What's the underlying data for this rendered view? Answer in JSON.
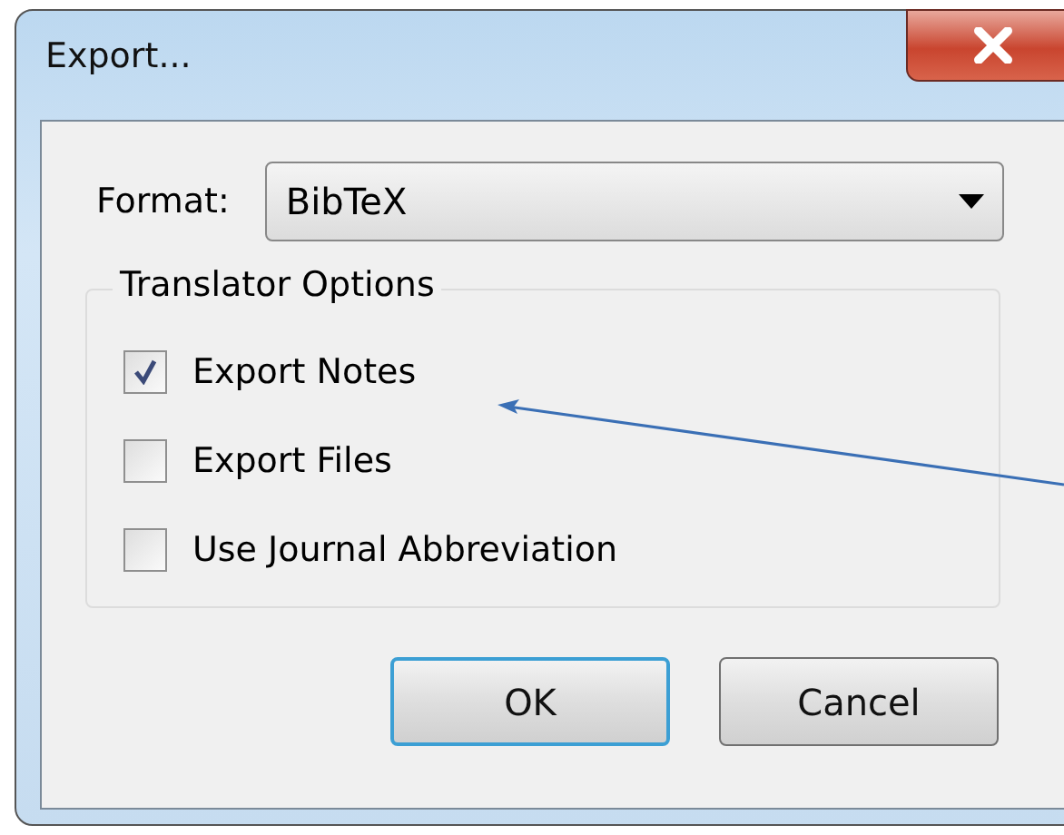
{
  "window": {
    "title": "Export..."
  },
  "format": {
    "label": "Format:",
    "value": "BibTeX"
  },
  "translator_options": {
    "title": "Translator Options",
    "options": [
      {
        "label": "Export Notes",
        "checked": true
      },
      {
        "label": "Export Files",
        "checked": false
      },
      {
        "label": "Use Journal Abbreviation",
        "checked": false
      }
    ]
  },
  "buttons": [
    {
      "label": "OK",
      "default": true
    },
    {
      "label": "Cancel",
      "default": false
    }
  ]
}
